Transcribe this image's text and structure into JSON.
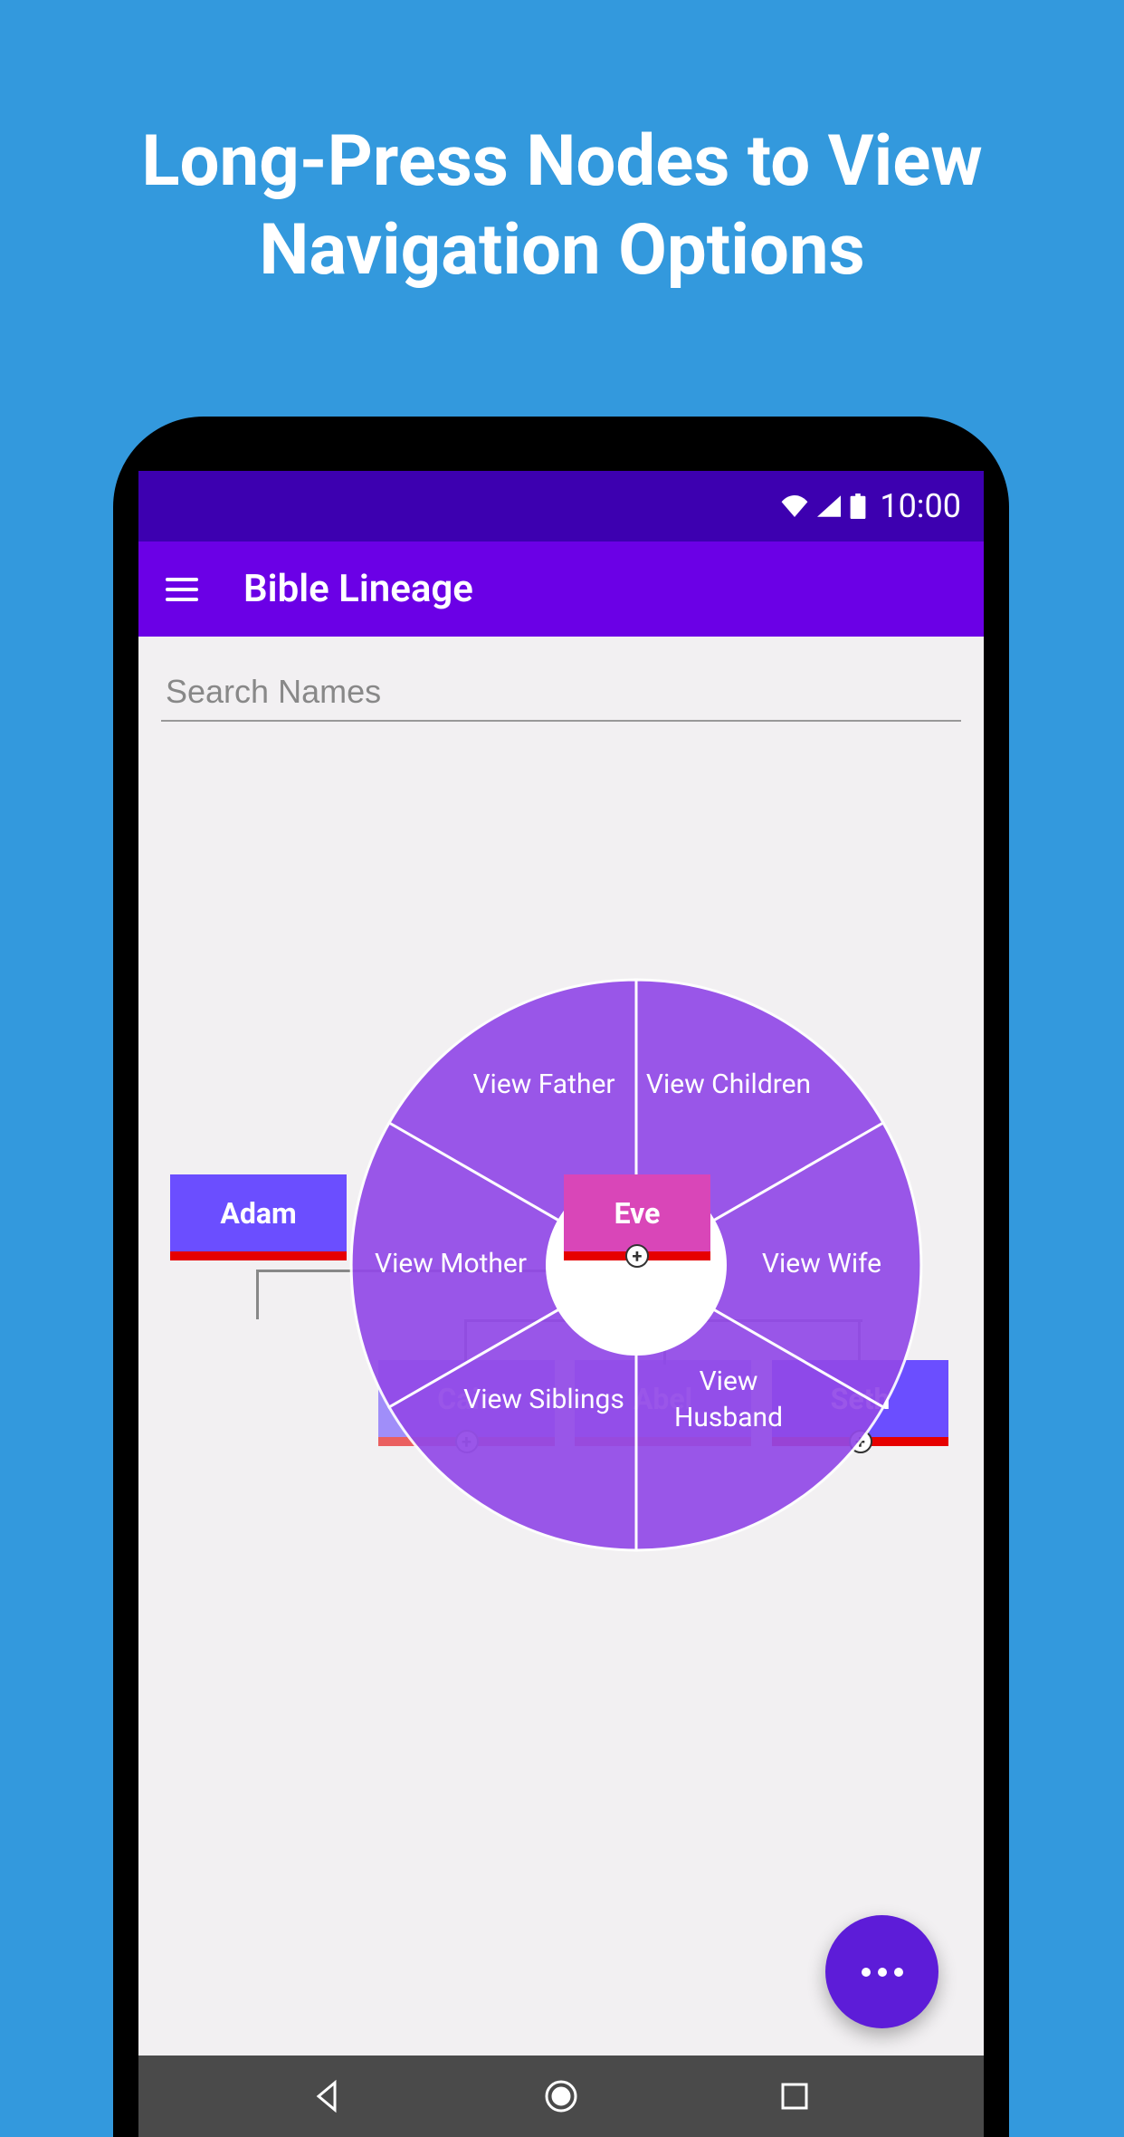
{
  "promo": {
    "title": "Long-Press Nodes to View Navigation Options"
  },
  "status": {
    "time": "10:00"
  },
  "app": {
    "title": "Bible Lineage"
  },
  "search": {
    "placeholder": "Search Names"
  },
  "nodes": {
    "adam": "Adam",
    "eve": "Eve",
    "cain": "Cain",
    "abel": "Abel",
    "seth": "Seth"
  },
  "radial": {
    "father": "View Father",
    "children": "View Children",
    "mother": "View Mother",
    "wife": "View Wife",
    "siblings": "View Siblings",
    "husband_line1": "View",
    "husband_line2": "Husband"
  }
}
